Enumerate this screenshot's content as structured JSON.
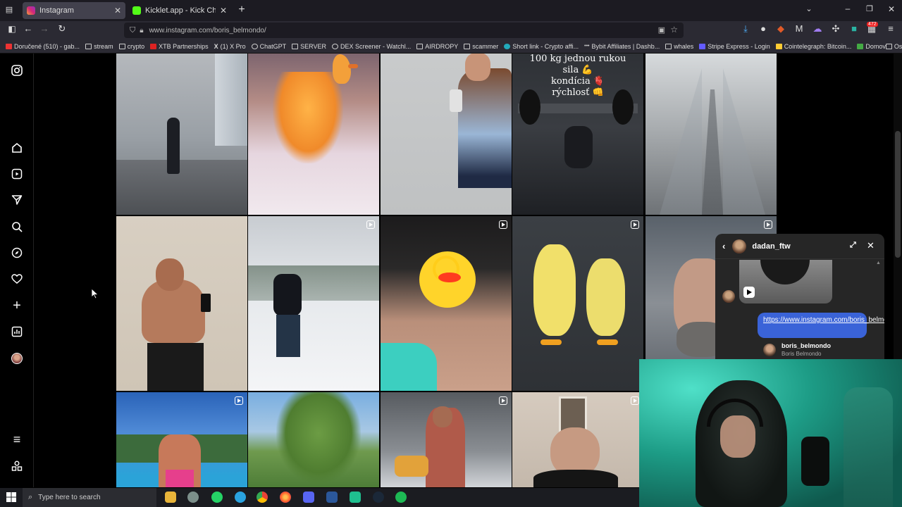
{
  "browser": {
    "tabs": [
      {
        "title": "Instagram",
        "active": true
      },
      {
        "title": "Kicklet.app - Kick Chatbot and O",
        "active": false
      }
    ],
    "url": "www.instagram.com/boris_belmondo/",
    "extension_badge": "472"
  },
  "bookmarks": [
    "Doručené (510) - gab...",
    "stream",
    "crypto",
    "XTB Partnerships",
    "(1) X Pro",
    "ChatGPT",
    "SERVER",
    "DEX Screener - Watchl...",
    "AIRDROPY",
    "scammer",
    "Short link - Crypto affi...",
    "Bybit Affiliates | Dashb...",
    "whales",
    "Stripe Express - Login",
    "Cointelegraph: Bitcoin...",
    "Domov",
    "Ostatné záložky"
  ],
  "grid": {
    "overlay_text": "100 kg jednou rukou\nsila 💪\nkondícia 🫀\nrýchlosť 👊"
  },
  "dm": {
    "username": "dadan_ftw",
    "message_link": "https://www.instagram.com/boris_belmondo/",
    "shared_profile": {
      "username": "boris_belmondo",
      "name": "Boris Belmondo"
    }
  },
  "taskbar": {
    "search_placeholder": "Type here to search"
  }
}
